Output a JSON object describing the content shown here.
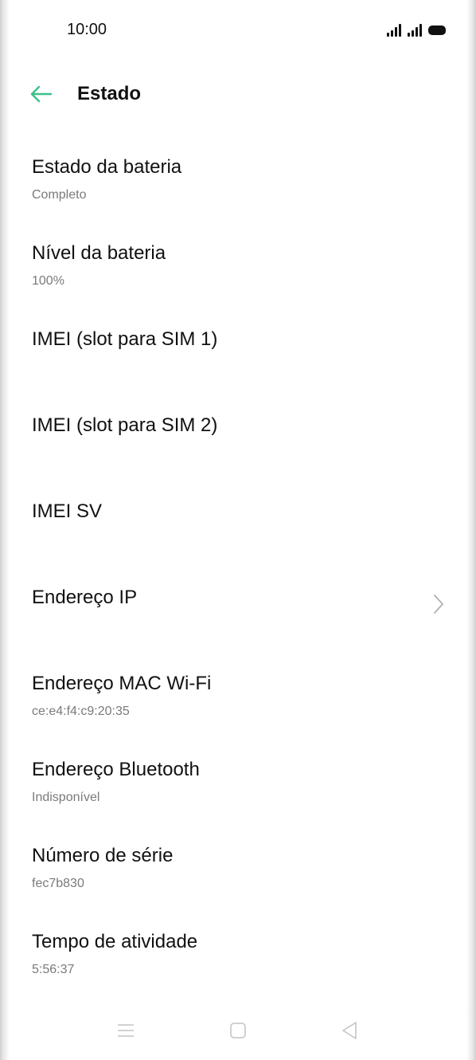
{
  "status_bar": {
    "time": "10:00",
    "icons": [
      "signal-icon",
      "signal-icon",
      "battery-icon"
    ]
  },
  "header": {
    "back_icon": "arrow-left-icon",
    "title": "Estado",
    "accent_color": "#3cc08a"
  },
  "items": [
    {
      "title": "Estado da bateria",
      "value": "Completo"
    },
    {
      "title": "Nível da bateria",
      "value": "100%"
    },
    {
      "title": "IMEI (slot para SIM 1)",
      "value": ""
    },
    {
      "title": "IMEI (slot para SIM 2)",
      "value": ""
    },
    {
      "title": "IMEI SV",
      "value": ""
    },
    {
      "title": "Endereço IP",
      "value": "",
      "chevron": "chevron-right-icon"
    },
    {
      "title": "Endereço MAC Wi-Fi",
      "value": "ce:e4:f4:c9:20:35"
    },
    {
      "title": "Endereço Bluetooth",
      "value": "Indisponível"
    },
    {
      "title": "Número de série",
      "value": "fec7b830"
    },
    {
      "title": "Tempo de atividade",
      "value": "5:56:37"
    }
  ],
  "nav_bar": {
    "icons": [
      "menu-icon",
      "home-square-icon",
      "back-triangle-icon"
    ]
  }
}
